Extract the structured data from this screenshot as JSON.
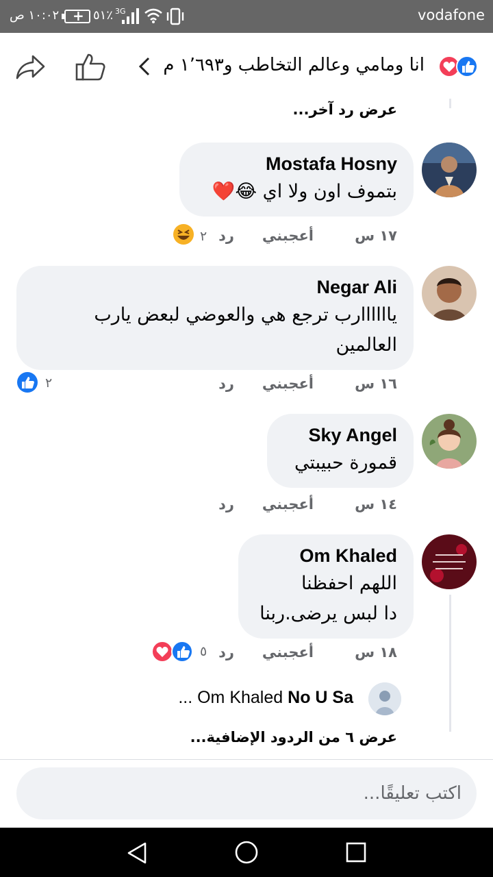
{
  "status_bar": {
    "carrier": "vodafone",
    "time": "١٠:٠٢ ص",
    "battery": "٥١٪",
    "network": "3G"
  },
  "header": {
    "title": "انا ومامي وعالم التخاطب و١٬٦٩٣ م...",
    "reactions": [
      "like-icon",
      "love-icon"
    ]
  },
  "thread": {
    "show_previous": "عرض رد آخر...",
    "comments": [
      {
        "name": "Mostafa Hosny",
        "text": "بتموف اون ولا اي 😂❤️",
        "time": "١٧ س",
        "like_label": "أعجبني",
        "reply_label": "رد",
        "reaction_count": "٢",
        "reactions": [
          "haha-icon"
        ]
      },
      {
        "name": "Negar Ali",
        "text": "ياااااارب ترجع هي والعوضي لبعض يارب العالمين",
        "time": "١٦ س",
        "like_label": "أعجبني",
        "reply_label": "رد",
        "reaction_count": "٢",
        "reactions": [
          "like-icon"
        ]
      },
      {
        "name": "Sky Angel",
        "text": "قمورة حبيبتي",
        "time": "١٤ س",
        "like_label": "أعجبني",
        "reply_label": "رد"
      },
      {
        "name": "Om Khaled",
        "text_line1": "اللهم احفظنا",
        "text_line2": "دا لبس يرضى.ربنا",
        "time": "١٨ س",
        "like_label": "أعجبني",
        "reply_label": "رد",
        "reaction_count": "٥",
        "reactions": [
          "like-icon",
          "love-icon"
        ],
        "reply_preview": {
          "author": "No U Sa",
          "mention": "... Om Khaled"
        },
        "more_replies": "عرض ٦ من الردود الإضافية..."
      }
    ]
  },
  "composer": {
    "placeholder": "اكتب تعليقًا..."
  },
  "colors": {
    "facebook_blue": "#1877f2",
    "love_red": "#f33e58",
    "bubble_gray": "#f0f2f5",
    "meta_gray": "#65676b"
  }
}
